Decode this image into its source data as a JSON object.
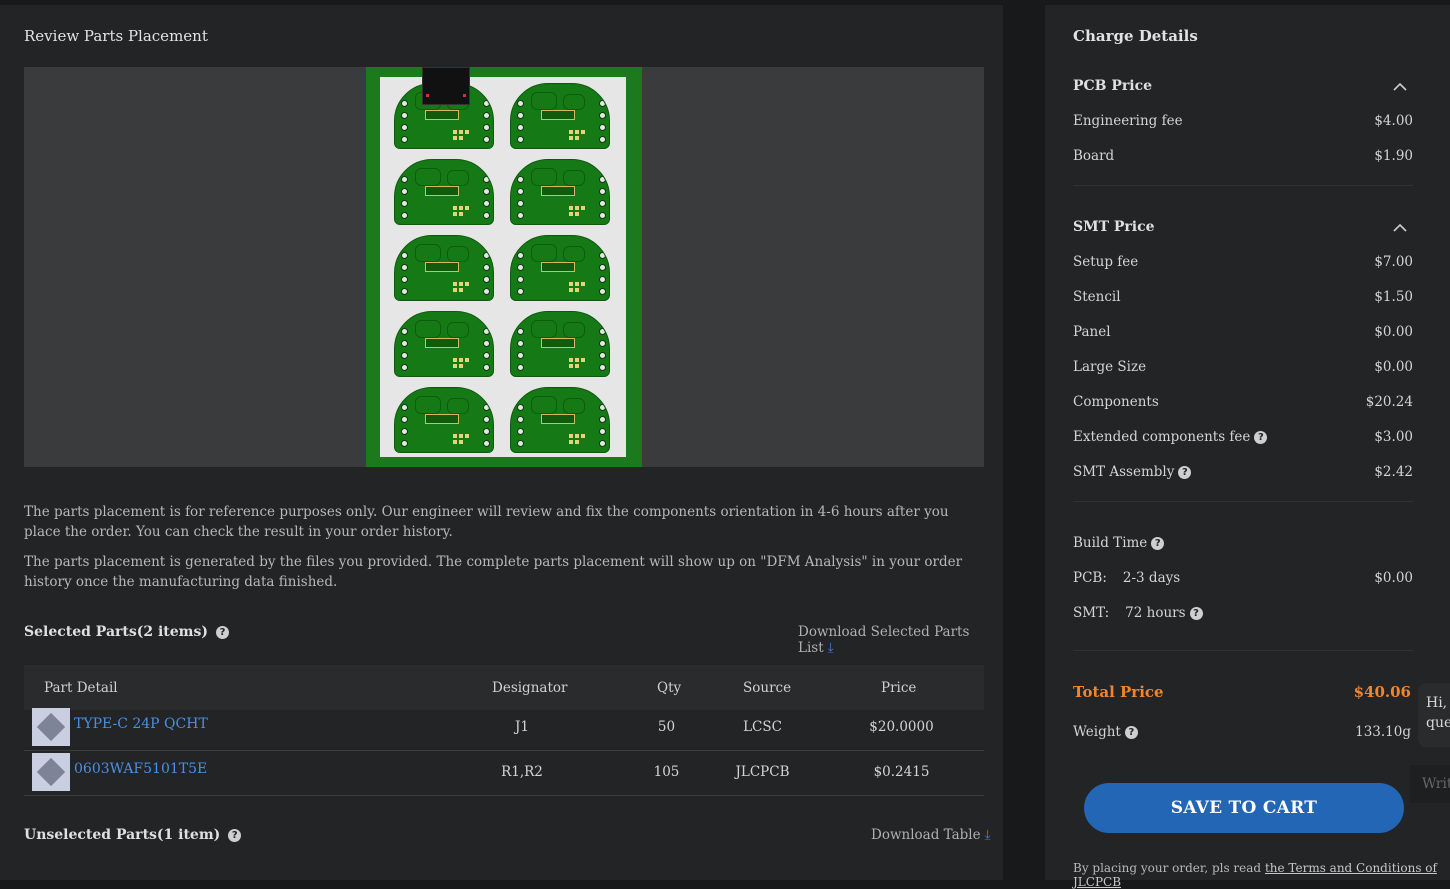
{
  "left": {
    "title": "Review Parts Placement",
    "notes": [
      "The parts placement is for reference purposes only. Our engineer will review and fix the components orientation in 4-6 hours after you place the order. You can check the result in your order history.",
      "The parts placement is generated by the files you provided. The complete parts placement will show up on \"DFM Analysis\" in your order history once the manufacturing data finished."
    ],
    "selected": {
      "heading": "Selected Parts(2 items)",
      "download": "Download Selected Parts List",
      "columns": [
        "Part Detail",
        "Designator",
        "Qty",
        "Source",
        "Price"
      ],
      "rows": [
        {
          "name": "TYPE-C 24P QCHT",
          "designator": "J1",
          "qty": "50",
          "source": "LCSC",
          "price": "$20.0000"
        },
        {
          "name": "0603WAF5101T5E",
          "designator": "R1,R2",
          "qty": "105",
          "source": "JLCPCB",
          "price": "$0.2415"
        }
      ]
    },
    "unselected": {
      "heading": "Unselected Parts(1 item)",
      "download": "Download Table"
    }
  },
  "charges": {
    "title": "Charge Details",
    "pcb": {
      "heading": "PCB Price",
      "items": [
        {
          "label": "Engineering fee",
          "value": "$4.00"
        },
        {
          "label": "Board",
          "value": "$1.90"
        }
      ]
    },
    "smt": {
      "heading": "SMT Price",
      "items": [
        {
          "label": "Setup fee",
          "value": "$7.00"
        },
        {
          "label": "Stencil",
          "value": "$1.50"
        },
        {
          "label": "Panel",
          "value": "$0.00"
        },
        {
          "label": "Large Size",
          "value": "$0.00"
        },
        {
          "label": "Components",
          "value": "$20.24"
        },
        {
          "label": "Extended components fee",
          "value": "$3.00"
        },
        {
          "label": "SMT Assembly",
          "value": "$2.42"
        }
      ]
    },
    "build": {
      "heading": "Build Time",
      "pcb_label": "PCB:",
      "pcb_time": "2-3 days",
      "pcb_value": "$0.00",
      "smt_label": "SMT:",
      "smt_time": "72 hours"
    },
    "total_label": "Total Price",
    "total_value": "$40.06",
    "weight_label": "Weight",
    "weight_value": "133.10g",
    "save_button": "SAVE TO CART",
    "terms_prefix": "By placing your order, pls read ",
    "terms_link": "the Terms and Conditions of JLCPCB"
  },
  "chat": {
    "greeting": "Hi, I",
    "greeting2": "que",
    "placeholder": "Writ"
  },
  "colors": {
    "accent": "#2366b6",
    "total": "#f0852d",
    "link": "#4a90e2"
  }
}
